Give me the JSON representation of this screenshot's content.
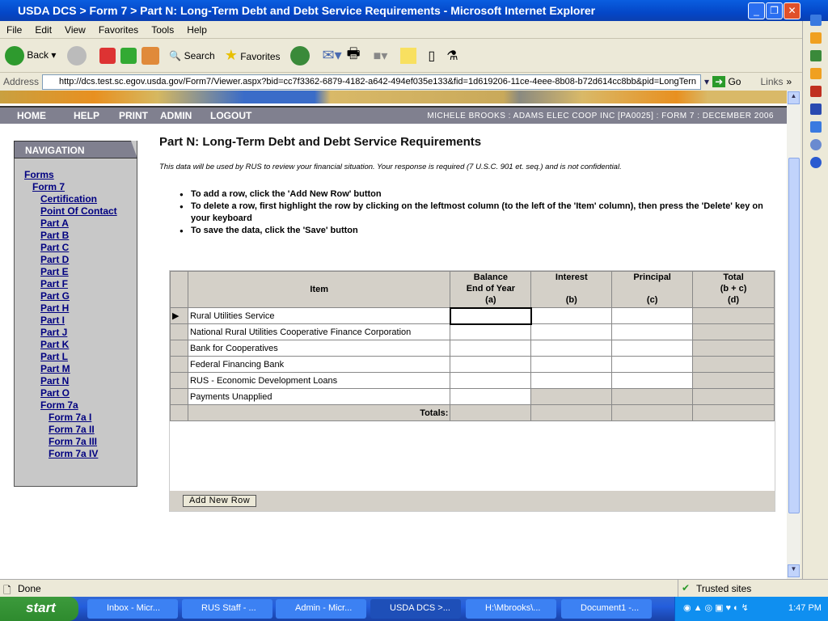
{
  "window": {
    "title": "USDA DCS > Form 7 > Part N: Long-Term Debt and Debt Service Requirements - Microsoft Internet Explorer"
  },
  "menu": [
    "File",
    "Edit",
    "View",
    "Favorites",
    "Tools",
    "Help"
  ],
  "toolbar": {
    "back": "Back",
    "search": "Search",
    "favorites": "Favorites"
  },
  "address": {
    "label": "Address",
    "url": "http://dcs.test.sc.egov.usda.gov/Form7/Viewer.aspx?bid=cc7f3362-6879-4182-a642-494ef035e133&fid=1d619206-11ce-4eee-8b08-b72d614cc8bb&pid=LongTern",
    "go": "Go",
    "links": "Links"
  },
  "nav": {
    "links": [
      "HOME",
      "HELP",
      "PRINT",
      "ADMIN",
      "LOGOUT"
    ],
    "user_info": "MICHELE BROOKS : ADAMS ELEC COOP INC [PA0025] : FORM 7 : DECEMBER 2006"
  },
  "navigation": {
    "heading": "NAVIGATION",
    "items": [
      {
        "label": "Forms",
        "level": 0
      },
      {
        "label": "Form 7",
        "level": 1
      },
      {
        "label": "Certification",
        "level": 2
      },
      {
        "label": "Point Of Contact",
        "level": 2
      },
      {
        "label": "Part A",
        "level": 2
      },
      {
        "label": "Part B",
        "level": 2
      },
      {
        "label": "Part C",
        "level": 2
      },
      {
        "label": "Part D",
        "level": 2
      },
      {
        "label": "Part E",
        "level": 2
      },
      {
        "label": "Part F",
        "level": 2
      },
      {
        "label": "Part G",
        "level": 2
      },
      {
        "label": "Part H",
        "level": 2
      },
      {
        "label": "Part I",
        "level": 2
      },
      {
        "label": "Part J",
        "level": 2
      },
      {
        "label": "Part K",
        "level": 2
      },
      {
        "label": "Part L",
        "level": 2
      },
      {
        "label": "Part M",
        "level": 2
      },
      {
        "label": "Part N",
        "level": 2
      },
      {
        "label": "Part O",
        "level": 2
      },
      {
        "label": "Form 7a",
        "level": 2
      },
      {
        "label": "Form 7a I",
        "level": 3
      },
      {
        "label": "Form 7a II",
        "level": 3
      },
      {
        "label": "Form 7a III",
        "level": 3
      },
      {
        "label": "Form 7a IV",
        "level": 3
      }
    ]
  },
  "main": {
    "title": "Part N: Long-Term Debt and Debt Service Requirements",
    "note": "This data will be used by RUS to review your financial situation. Your response is required (7 U.S.C. 901 et. seq.) and is not confidential.",
    "instructions": [
      "To add a row, click the 'Add New Row' button",
      "To delete a row, first highlight the row by clicking on the leftmost column (to the left of the 'Item' column), then press the 'Delete' key on your keyboard",
      "To save the data, click the 'Save' button"
    ],
    "columns": [
      {
        "line1": "",
        "line2": "Item",
        "line3": ""
      },
      {
        "line1": "Balance",
        "line2": "End of Year",
        "line3": "(a)"
      },
      {
        "line1": "Interest",
        "line2": "",
        "line3": "(b)"
      },
      {
        "line1": "Principal",
        "line2": "",
        "line3": "(c)"
      },
      {
        "line1": "Total",
        "line2": "(b + c)",
        "line3": "(d)"
      }
    ],
    "rows": [
      "Rural Utilities Service",
      "National Rural Utilities Cooperative Finance Corporation",
      "Bank for Cooperatives",
      "Federal Financing Bank",
      "RUS - Economic Development Loans",
      "Payments Unapplied"
    ],
    "totals_label": "Totals:",
    "add_row": "Add New Row"
  },
  "status": {
    "text": "Done",
    "zone": "Trusted sites"
  },
  "taskbar": {
    "start": "start",
    "tasks": [
      "Inbox - Micr...",
      "RUS Staff - ...",
      "Admin - Micr...",
      "USDA DCS >...",
      "H:\\Mbrooks\\...",
      "Document1 -..."
    ],
    "clock": "1:47 PM"
  }
}
